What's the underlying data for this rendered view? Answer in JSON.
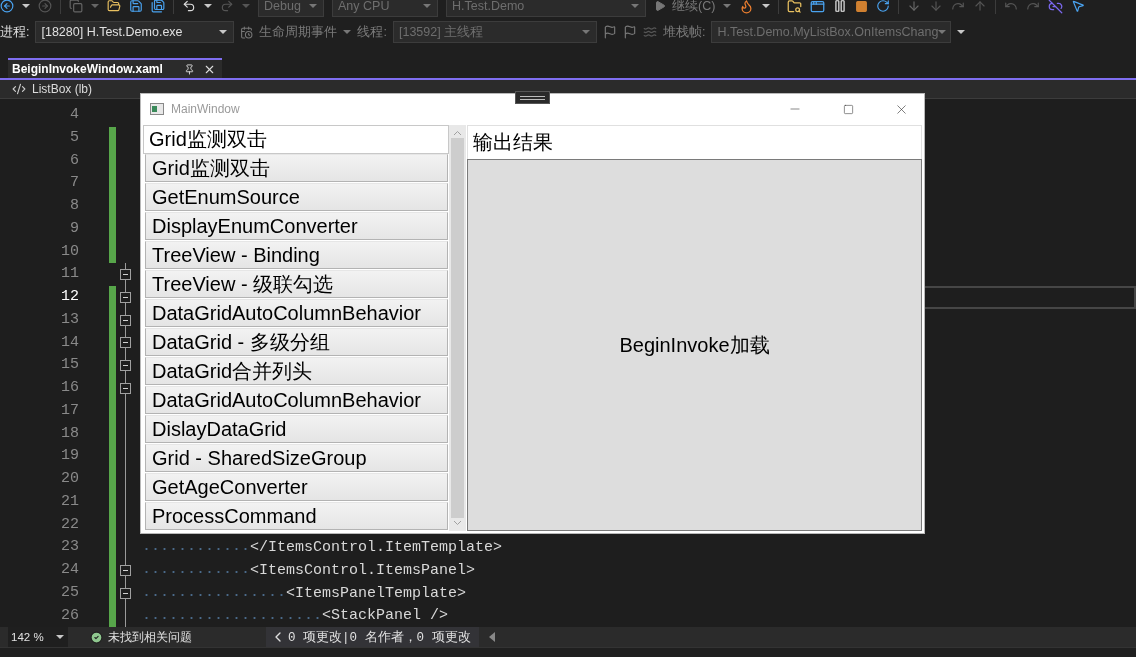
{
  "toolbar": {
    "configuration": "Debug",
    "platform": "Any CPU",
    "startup_project": "H.Test.Demo",
    "continue_label": "继续(C)"
  },
  "debug_location": {
    "process_label": "进程:",
    "process": "[18280] H.Test.Demo.exe",
    "lifecycle_events": "生命周期事件",
    "thread_label": "线程:",
    "thread": "[13592] 主线程",
    "stack_frame_label": "堆栈帧:",
    "stack_frame": "H.Test.Demo.MyListBox.OnItemsChang"
  },
  "tabs": [
    {
      "label": "BeiginInvokeWindow.xaml",
      "selected": true
    }
  ],
  "navigation": {
    "element": "ListBox (lb)"
  },
  "editor": {
    "lines": [
      {
        "number": "4",
        "changed": false,
        "foldable": false,
        "current": false
      },
      {
        "number": "5",
        "changed": true,
        "foldable": false,
        "current": false
      },
      {
        "number": "6",
        "changed": true,
        "foldable": false,
        "current": false
      },
      {
        "number": "7",
        "changed": true,
        "foldable": false,
        "current": false
      },
      {
        "number": "8",
        "changed": true,
        "foldable": false,
        "current": false
      },
      {
        "number": "9",
        "changed": true,
        "foldable": false,
        "current": false
      },
      {
        "number": "10",
        "changed": true,
        "foldable": false,
        "current": false
      },
      {
        "number": "11",
        "changed": false,
        "foldable": true,
        "current": false
      },
      {
        "number": "12",
        "changed": true,
        "foldable": true,
        "current": true
      },
      {
        "number": "13",
        "changed": true,
        "foldable": true,
        "current": false
      },
      {
        "number": "14",
        "changed": true,
        "foldable": true,
        "current": false
      },
      {
        "number": "15",
        "changed": true,
        "foldable": true,
        "current": false
      },
      {
        "number": "16",
        "changed": true,
        "foldable": true,
        "current": false
      },
      {
        "number": "17",
        "changed": true,
        "foldable": false,
        "current": false
      },
      {
        "number": "18",
        "changed": true,
        "foldable": false,
        "current": false
      },
      {
        "number": "19",
        "changed": true,
        "foldable": false,
        "current": false
      },
      {
        "number": "20",
        "changed": true,
        "foldable": false,
        "current": false
      },
      {
        "number": "21",
        "changed": true,
        "foldable": false,
        "current": false
      },
      {
        "number": "22",
        "changed": true,
        "foldable": false,
        "current": false
      },
      {
        "number": "23",
        "changed": true,
        "foldable": false,
        "current": false,
        "code": "            </ItemsControl.ItemTemplate>"
      },
      {
        "number": "24",
        "changed": true,
        "foldable": true,
        "current": false,
        "code": "            <ItemsControl.ItemsPanel>"
      },
      {
        "number": "25",
        "changed": true,
        "foldable": true,
        "current": false,
        "code": "                <ItemsPanelTemplate>"
      },
      {
        "number": "26",
        "changed": true,
        "foldable": false,
        "current": false,
        "code": "                    <StackPanel />"
      }
    ]
  },
  "status_bar": {
    "zoom": "142 %",
    "issues": "未找到相关问题",
    "changes": "0 项更改|0 名作者，0 项更改"
  },
  "app_window": {
    "title": "MainWindow",
    "list": {
      "header": "Grid监测双击",
      "items": [
        "Grid监测双击",
        "GetEnumSource",
        "DisplayEnumConverter",
        "TreeView - Binding",
        "TreeView - 级联勾选",
        "DataGridAutoColumnBehavior",
        "DataGrid - 多级分组",
        "DataGrid合并列头",
        "DataGridAutoColumnBehavior",
        "DislayDataGrid",
        "Grid - SharedSizeGroup",
        "GetAgeConverter",
        "ProcessCommand"
      ]
    },
    "output": {
      "title": "输出结果",
      "text": "BeginInvoke加载"
    }
  }
}
